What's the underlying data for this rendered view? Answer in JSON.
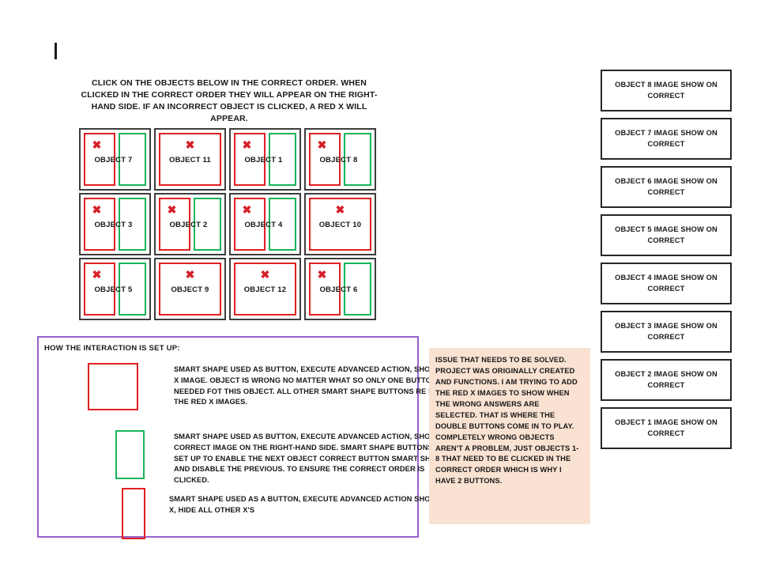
{
  "instructions": {
    "text": "CLICK ON THE OBJECTS BELOW IN THE CORRECT ORDER. WHEN CLICKED IN THE CORRECT ORDER THEY WILL APPEAR ON THE RIGHT-HAND SIDE. IF AN INCORRECT OBJECT IS CLICKED, A RED X WILL APPEAR."
  },
  "colors": {
    "red": "#e02020",
    "green": "#18b45c",
    "cell_border": "#3d3d3d",
    "legend_border": "#9a62c8",
    "note_background": "#fae2d2",
    "x_mark": "#d6212a"
  },
  "grid": {
    "x_glyph": "✖",
    "cells": [
      {
        "label": "OBJECT 7",
        "layout": "split"
      },
      {
        "label": "OBJECT 11",
        "layout": "single"
      },
      {
        "label": "OBJECT 1",
        "layout": "split"
      },
      {
        "label": "OBJECT 8",
        "layout": "split"
      },
      {
        "label": "OBJECT 3",
        "layout": "split"
      },
      {
        "label": "OBJECT 2",
        "layout": "split"
      },
      {
        "label": "OBJECT 4",
        "layout": "split"
      },
      {
        "label": "OBJECT 10",
        "layout": "single"
      },
      {
        "label": "OBJECT 5",
        "layout": "split"
      },
      {
        "label": "OBJECT 9",
        "layout": "single"
      },
      {
        "label": "OBJECT 12",
        "layout": "single"
      },
      {
        "label": "OBJECT 6",
        "layout": "split"
      }
    ]
  },
  "right_panel": {
    "items": [
      {
        "label": "OBJECT 8 IMAGE SHOW ON CORRECT"
      },
      {
        "label": "OBJECT 7 IMAGE SHOW ON CORRECT"
      },
      {
        "label": "OBJECT 6 IMAGE SHOW ON CORRECT"
      },
      {
        "label": "OBJECT 5 IMAGE SHOW ON CORRECT"
      },
      {
        "label": "OBJECT 4 IMAGE SHOW ON CORRECT"
      },
      {
        "label": "OBJECT 3 IMAGE SHOW ON CORRECT"
      },
      {
        "label": "OBJECT 2 IMAGE SHOW ON CORRECT"
      },
      {
        "label": "OBJECT 1 IMAGE SHOW ON CORRECT"
      }
    ]
  },
  "legend": {
    "title": "HOW THE INTERACTION IS SET UP:",
    "rows": [
      {
        "swatch": "red",
        "text": "SMART SHAPE USED AS BUTTON, EXECUTE ADVANCED ACTION, SHOW RED X IMAGE. OBJECT IS WRONG NO MATTER WHAT SO ONLY ONE BUTTON IS NEEDED FOT THIS OBJECT. ALL OTHER SMART SHAPE BUTTONS RE HIDE THE RED X IMAGES."
      },
      {
        "swatch": "green",
        "text": "SMART SHAPE USED AS BUTTON, EXECUTE ADVANCED ACTION, SHOW THE CORRECT IMAGE ON THE RIGHT-HAND SIDE. SMART SHAPE BUTTONS ARE SET UP TO ENABLE THE NEXT OBJECT CORRECT BUTTON SMART SHAPE AND DISABLE THE PREVIOUS. TO ENSURE THE CORRECT ORDER IS CLICKED."
      },
      {
        "swatch": "red",
        "text": "SMART SHAPE USED AS A BUTTON, EXECUTE ADVANCED ACTION SHOW X, HIDE ALL OTHER X'S"
      }
    ]
  },
  "issue_note": {
    "text": "ISSUE THAT NEEDS TO BE SOLVED. PROJECT WAS ORIGINALLY CREATED AND FUNCTIONS. I AM TRYING TO ADD THE RED X IMAGES TO SHOW WHEN THE WRONG ANSWERS ARE SELECTED. THAT IS WHERE THE DOUBLE BUTTONS COME IN TO PLAY. COMPLETELY WRONG OBJECTS AREN'T A PROBLEM, JUST OBJECTS 1-8 THAT NEED TO BE CLICKED IN THE CORRECT ORDER WHICH IS WHY I HAVE 2 BUTTONS."
  }
}
